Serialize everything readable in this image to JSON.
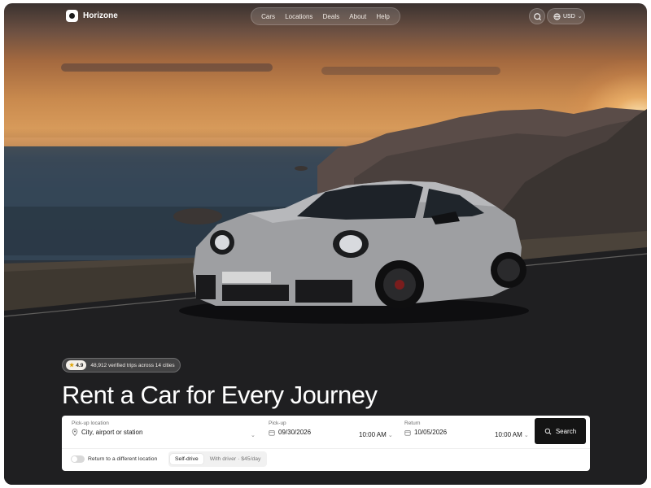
{
  "brand": {
    "name": "Horizone",
    "logo_icon": "horizone-logo-icon"
  },
  "nav": {
    "links": [
      "Cars",
      "Locations",
      "Deals",
      "About",
      "Help"
    ]
  },
  "header_actions": {
    "search_icon": "search-icon",
    "globe_icon": "globe-icon",
    "currency": "USD"
  },
  "rating": {
    "score": "4.9",
    "text": "48,912 verified trips across 14 cities"
  },
  "hero": {
    "title": "Rent a Car for Every Journey"
  },
  "search": {
    "pickup_location_label": "Pick-up location",
    "pickup_location_placeholder": "City, airport or station",
    "pickup_label": "Pick-up",
    "pickup_date": "09/30/2026",
    "pickup_time": "10:00 AM",
    "return_label": "Return",
    "return_date": "10/05/2026",
    "return_time": "10:00 AM",
    "search_button": "Search",
    "return_toggle_label": "Return to a different location",
    "return_toggle_on": false,
    "modes": [
      "Self-drive",
      "With driver · $45/day"
    ],
    "active_mode": "Self-drive"
  },
  "colors": {
    "accent": "#141414",
    "card": "#ffffff"
  }
}
